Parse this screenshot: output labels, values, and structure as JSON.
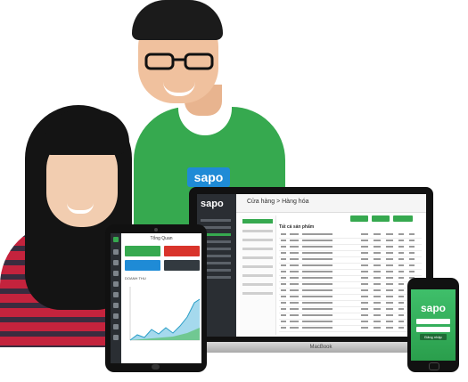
{
  "scene": {
    "description_colors": {
      "shirt": "#36a94f",
      "brand_blue": "#1f8bd6",
      "top_red": "#c4233d"
    }
  },
  "shirt_badge": {
    "text": "sapo"
  },
  "laptop": {
    "brand": "MacBook",
    "logo": "sapo",
    "breadcrumb": "Cửa hàng > Hàng hóa",
    "table_title": "Tất cả sản phẩm"
  },
  "tablet": {
    "title": "Tổng Quan",
    "chart_label": "DOANH THU"
  },
  "phone": {
    "logo": "sapo",
    "login_button": "Đăng nhập"
  }
}
